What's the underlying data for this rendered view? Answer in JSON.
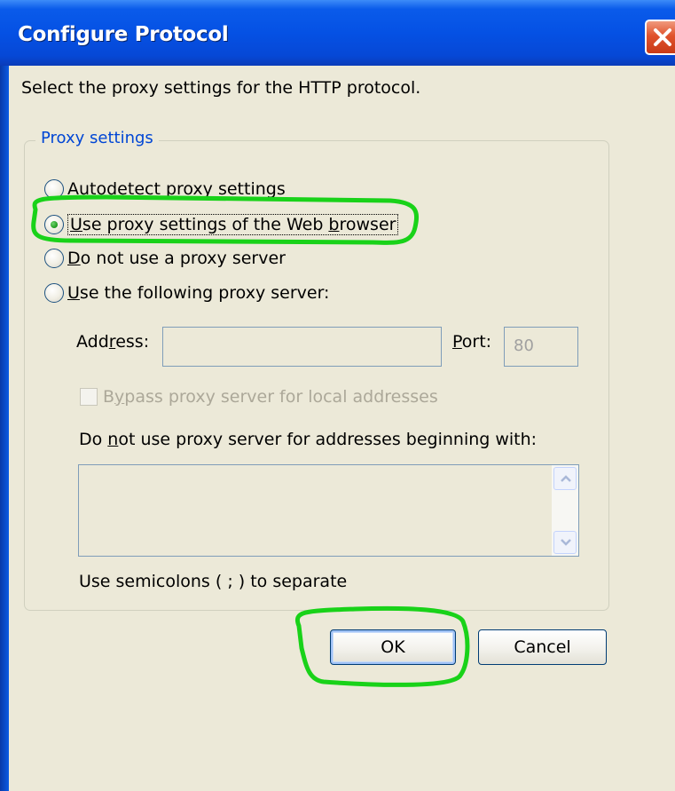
{
  "window": {
    "title": "Configure Protocol",
    "description": "Select the proxy settings for the HTTP protocol."
  },
  "proxy_group": {
    "label": "Proxy settings",
    "options": [
      {
        "first": "A",
        "rest": "utodetect proxy settings",
        "selected": false
      },
      {
        "first": "U",
        "rest": "se proxy settings of the Web ",
        "tail_u": "b",
        "tail": "rowser",
        "selected": true
      },
      {
        "first": "D",
        "rest": "o not use a proxy server",
        "selected": false
      },
      {
        "first": "U",
        "rest": "se the following proxy server:",
        "selected": false
      }
    ],
    "address": {
      "label_a": "Add",
      "label_u": "r",
      "label_b": "ess:",
      "value": ""
    },
    "port": {
      "label_u": "P",
      "label_b": "ort:",
      "value": "80"
    },
    "bypass": {
      "label_a": "B",
      "label_u": "y",
      "label_b": "pass proxy server for local addresses",
      "checked": false
    },
    "exceptions": {
      "label_a": "Do ",
      "label_u": "n",
      "label_b": "ot use proxy server for addresses beginning with:",
      "value": ""
    },
    "semicolon_note": "Use semicolons ( ; ) to separate"
  },
  "buttons": {
    "ok": "OK",
    "cancel": "Cancel"
  },
  "colors": {
    "highlight": "#19d219",
    "title_bar": "#0551e4",
    "dialog_bg": "#ece9d8"
  }
}
